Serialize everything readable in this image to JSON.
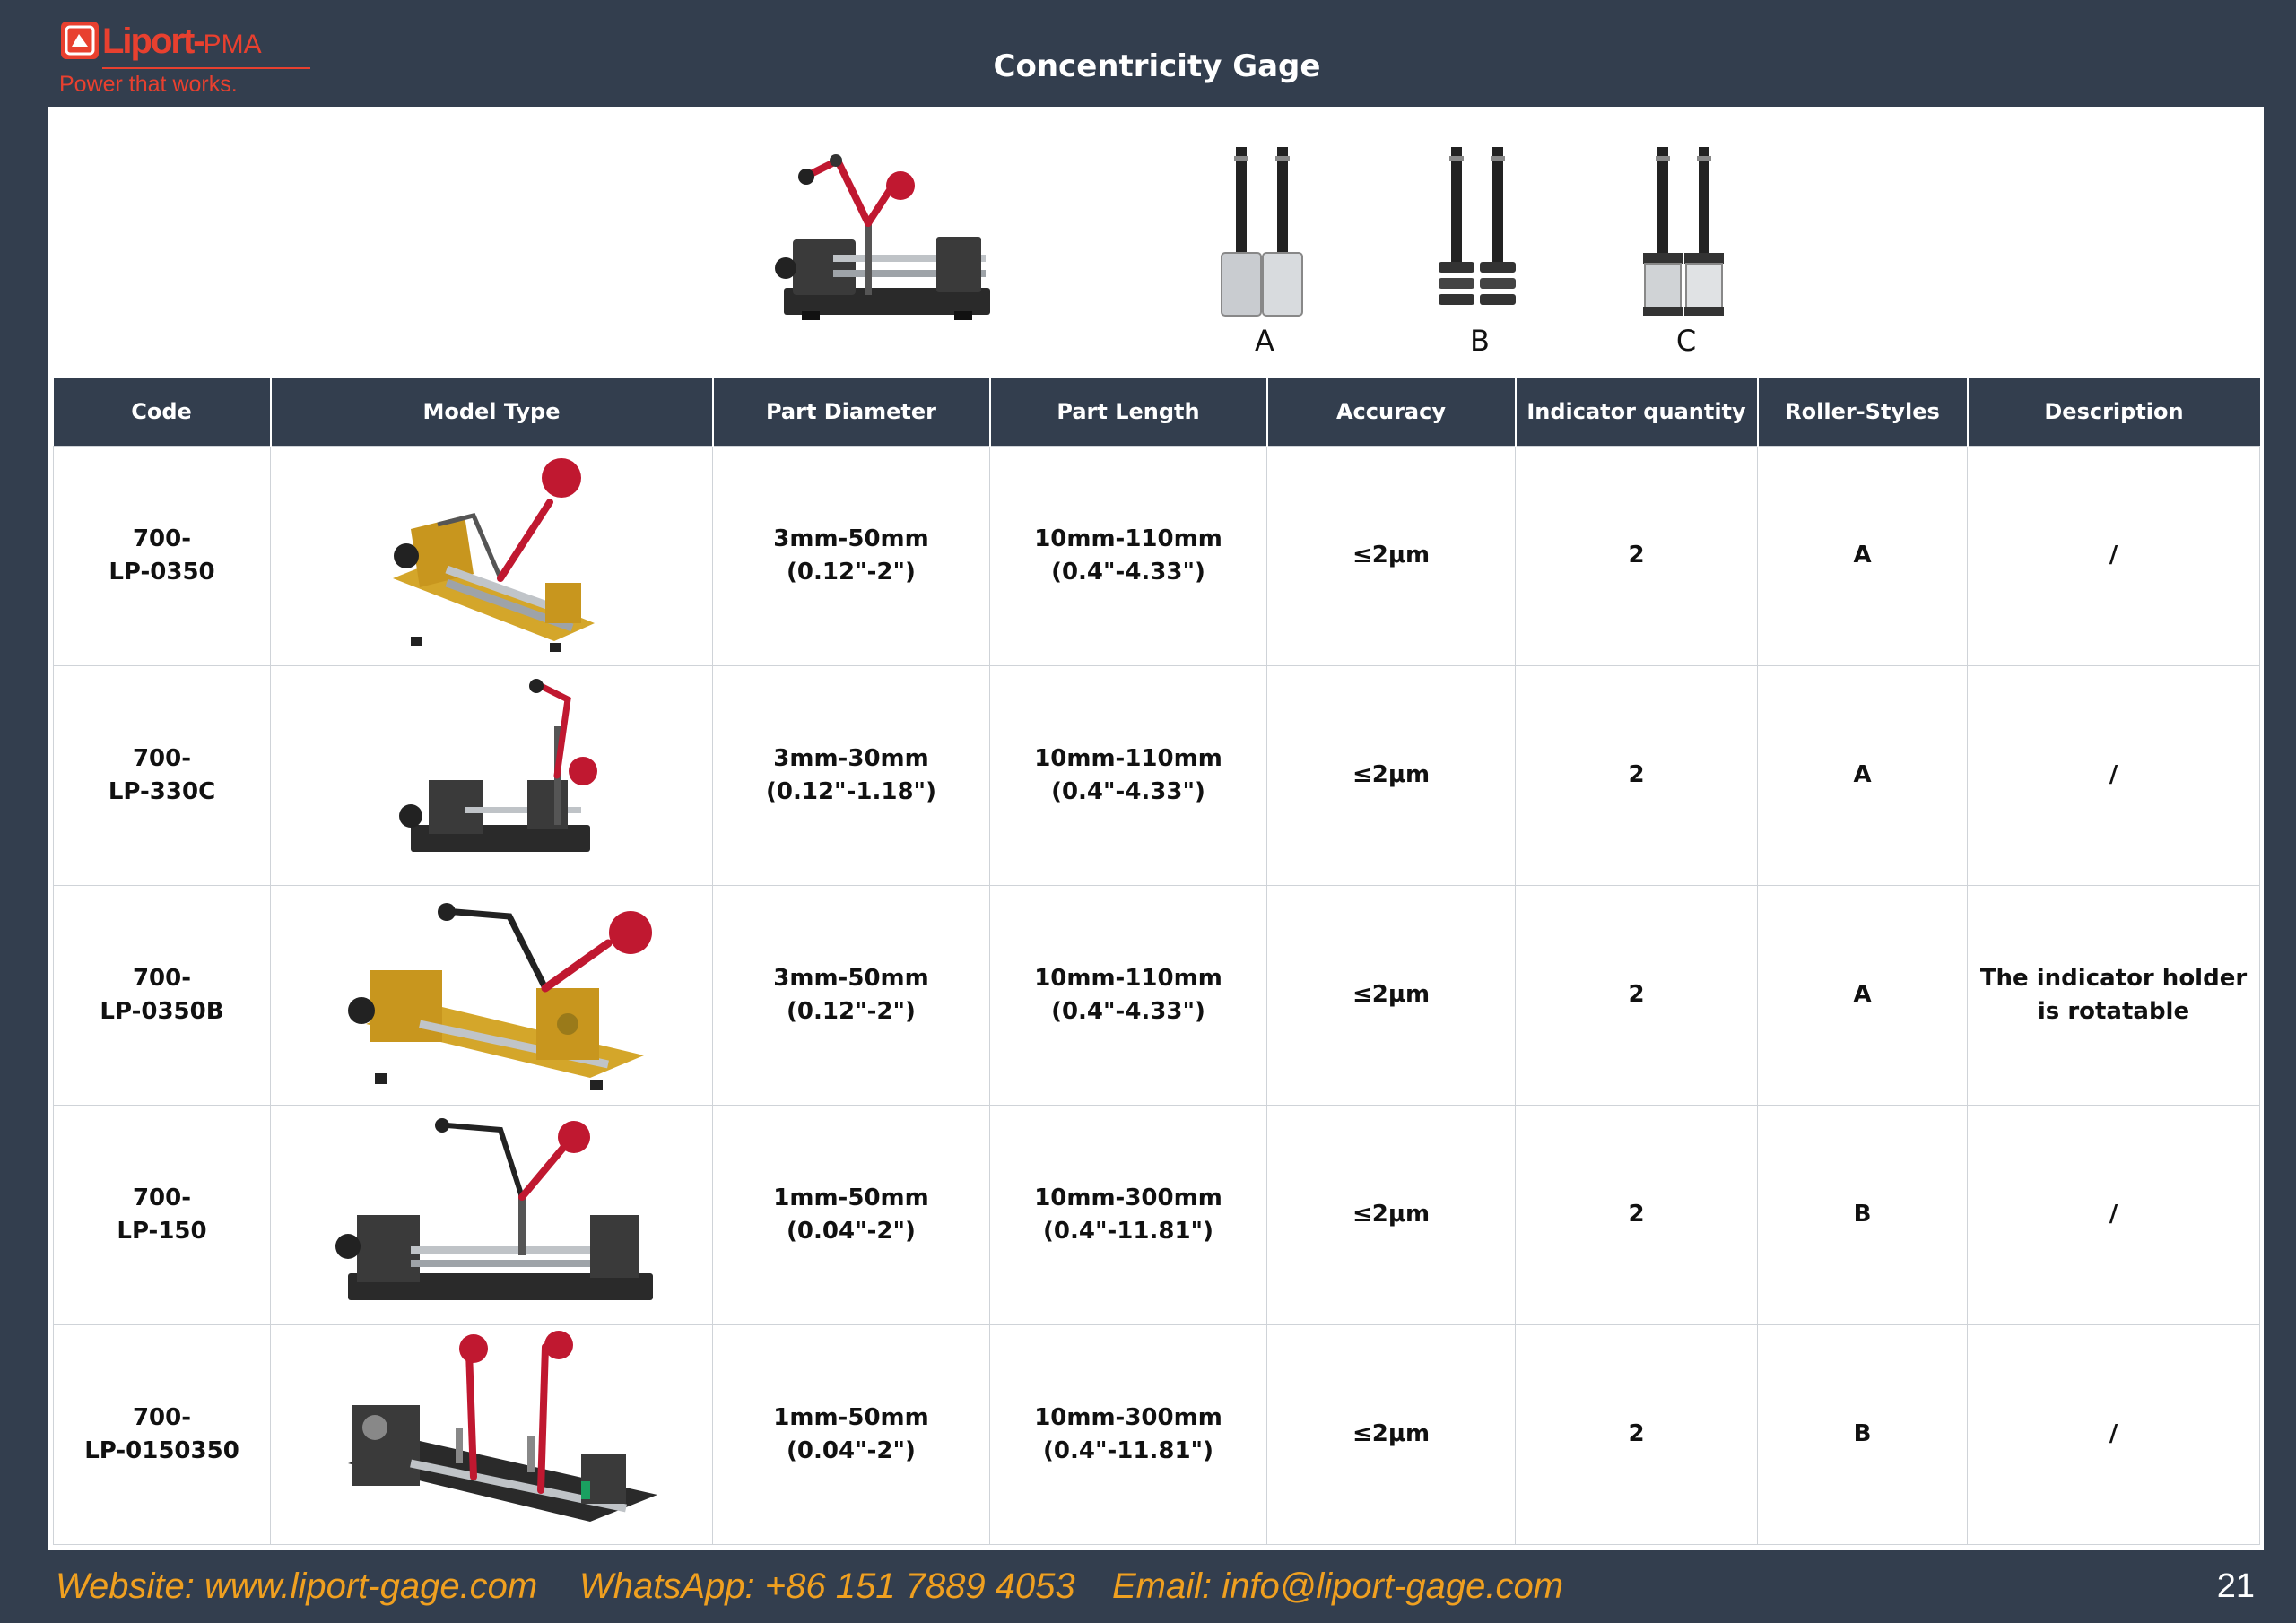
{
  "header": {
    "logo_name": "Liport-",
    "logo_suffix": "PMA",
    "slogan": "Power that works.",
    "title": "Concentricity Gage"
  },
  "rollers": [
    {
      "label": "A",
      "style": "smooth-cylinder"
    },
    {
      "label": "B",
      "style": "grooved-rings"
    },
    {
      "label": "C",
      "style": "flanged-cylinder"
    }
  ],
  "table": {
    "columns": [
      "Code",
      "Model Type",
      "Part Diameter",
      "Part Length",
      "Accuracy",
      "Indicator quantity",
      "Roller-Styles",
      "Description"
    ],
    "rows": [
      {
        "code": [
          "700-",
          "LP-0350"
        ],
        "image": "gold-base-gage",
        "diameter": [
          "3mm-50mm",
          "(0.12\"-2\")"
        ],
        "length": [
          "10mm-110mm",
          "(0.4\"-4.33\")"
        ],
        "accuracy": "≤2μm",
        "indicators": "2",
        "roller": "A",
        "description": [
          "/",
          ""
        ]
      },
      {
        "code": [
          "700-",
          "LP-330C"
        ],
        "image": "black-compact-gage",
        "diameter": [
          "3mm-30mm",
          "(0.12\"-1.18\")"
        ],
        "length": [
          "10mm-110mm",
          "(0.4\"-4.33\")"
        ],
        "accuracy": "≤2μm",
        "indicators": "2",
        "roller": "A",
        "description": [
          "/",
          ""
        ]
      },
      {
        "code": [
          "700-",
          "LP-0350B"
        ],
        "image": "gold-rotatable-gage",
        "diameter": [
          "3mm-50mm",
          "(0.12\"-2\")"
        ],
        "length": [
          "10mm-110mm",
          "(0.4\"-4.33\")"
        ],
        "accuracy": "≤2μm",
        "indicators": "2",
        "roller": "A",
        "description": [
          "The indicator holder",
          "is rotatable"
        ]
      },
      {
        "code": [
          "700-",
          "LP-150"
        ],
        "image": "black-long-gage",
        "diameter": [
          "1mm-50mm",
          "(0.04\"-2\")"
        ],
        "length": [
          "10mm-300mm",
          "(0.4\"-11.81\")"
        ],
        "accuracy": "≤2μm",
        "indicators": "2",
        "roller": "B",
        "description": [
          "/",
          ""
        ]
      },
      {
        "code": [
          "700-",
          "LP-0150350"
        ],
        "image": "black-dual-indicator-gage",
        "diameter": [
          "1mm-50mm",
          "(0.04\"-2\")"
        ],
        "length": [
          "10mm-300mm",
          "(0.4\"-11.81\")"
        ],
        "accuracy": "≤2μm",
        "indicators": "2",
        "roller": "B",
        "description": [
          "/",
          ""
        ]
      }
    ]
  },
  "footer": {
    "website": "Website: www.liport-gage.com",
    "whatsapp": "WhatsApp: +86 151 7889 4053",
    "email": "Email: info@liport-gage.com",
    "page_number": "21"
  },
  "colors": {
    "background": "#333e4e",
    "header_cell": "#333e4e",
    "brand_red": "#e8402f",
    "footer_text": "#f0a020",
    "gold": "#d4a62a",
    "indicator_red": "#c01830"
  }
}
